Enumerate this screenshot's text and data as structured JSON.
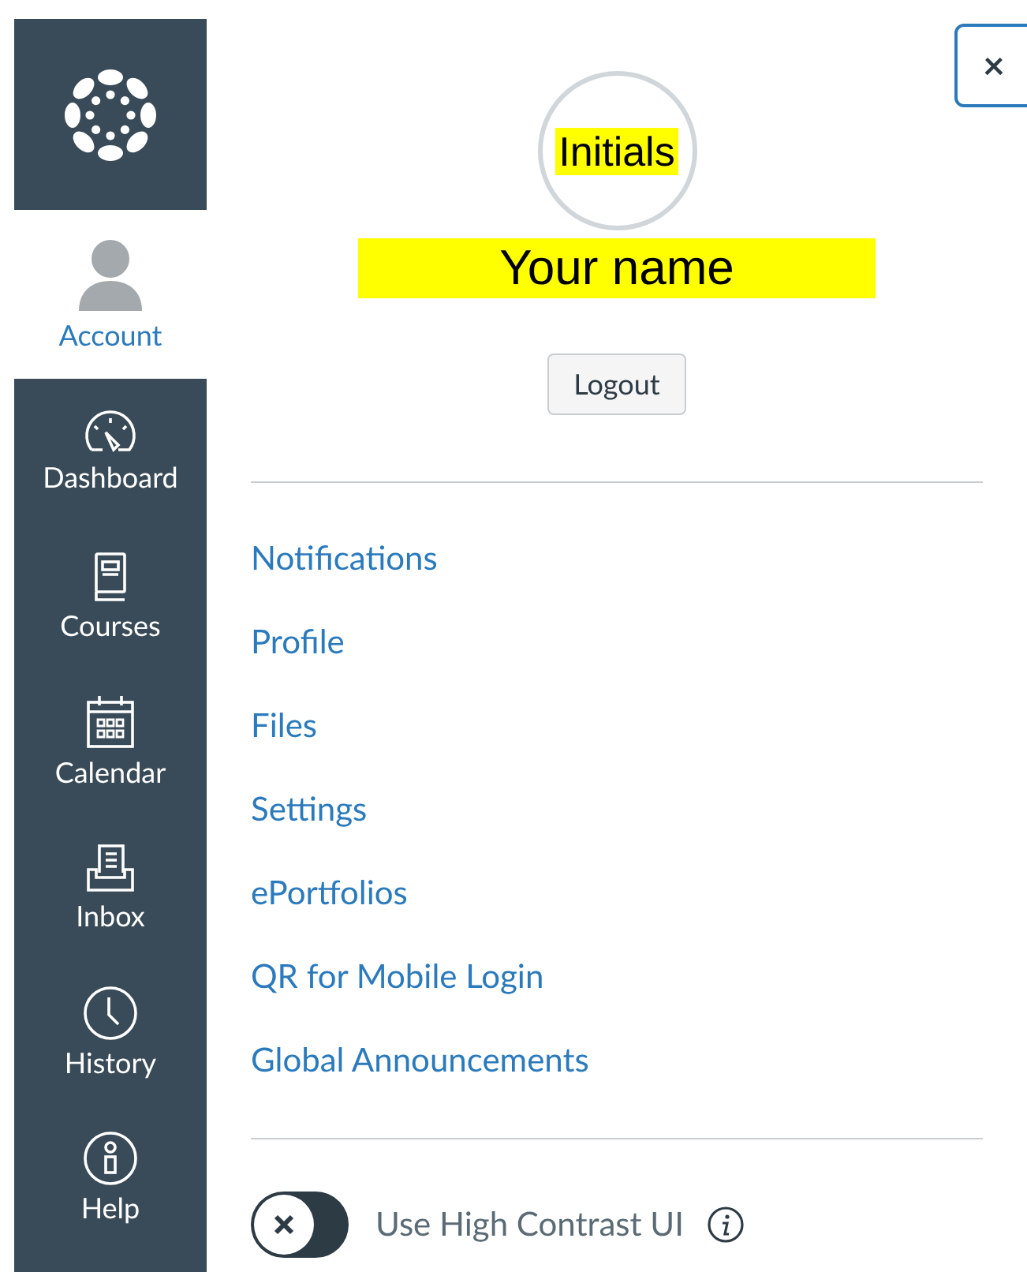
{
  "nav": [
    {
      "label": "Account",
      "selected": true
    },
    {
      "label": "Dashboard",
      "selected": false
    },
    {
      "label": "Courses",
      "selected": false
    },
    {
      "label": "Calendar",
      "selected": false
    },
    {
      "label": "Inbox",
      "selected": false
    },
    {
      "label": "History",
      "selected": false
    },
    {
      "label": "Help",
      "selected": false
    }
  ],
  "close": "×",
  "profile": {
    "initials": "Initials",
    "name": "Your name",
    "logout": "Logout"
  },
  "links": [
    "Notifications",
    "Profile",
    "Files",
    "Settings",
    "ePortfolios",
    "QR for Mobile Login",
    "Global Announcements"
  ],
  "high_contrast": {
    "label": "Use High Contrast UI",
    "checked": false
  }
}
